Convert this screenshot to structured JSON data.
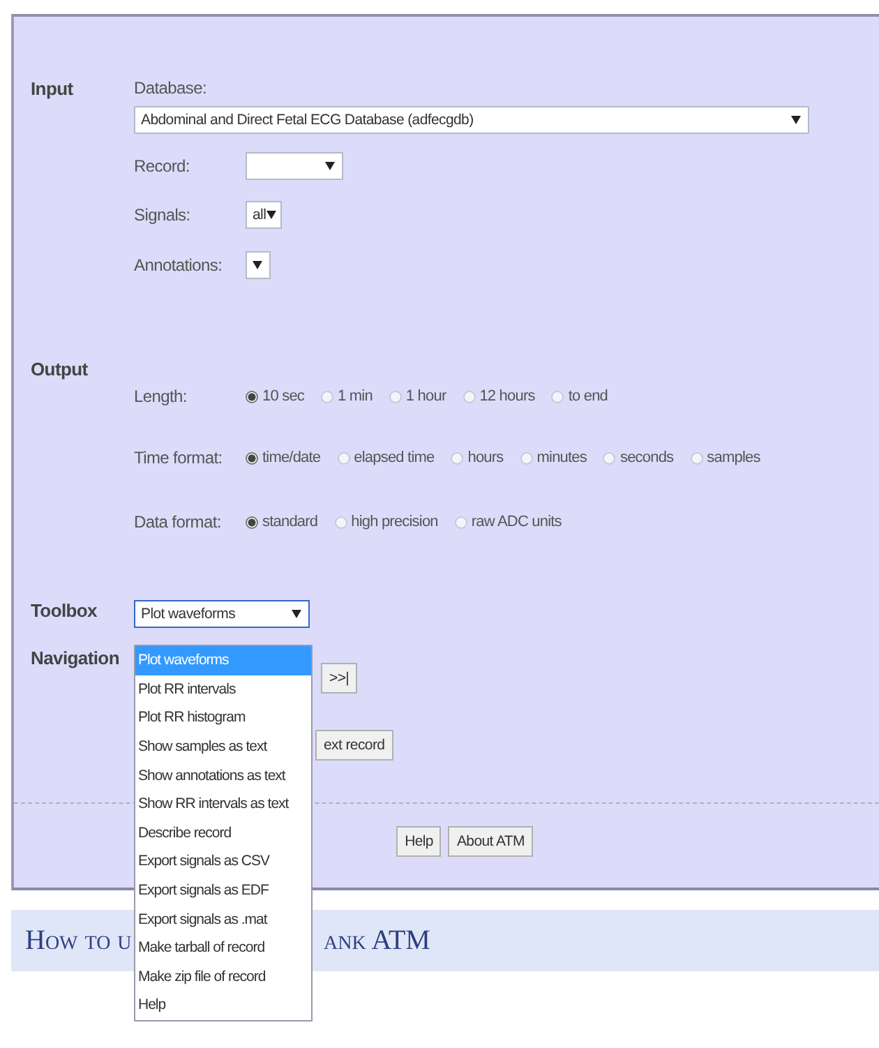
{
  "input": {
    "label": "Input",
    "database": {
      "label": "Database:",
      "value": "Abdominal and Direct Fetal ECG Database (adfecgdb)"
    },
    "fields": [
      {
        "label": "Record:"
      },
      {
        "label": "Signals:",
        "value": "all"
      },
      {
        "label": "Annotations:"
      }
    ]
  },
  "output": {
    "label": "Output",
    "groups": [
      {
        "label": "Length:",
        "options": [
          {
            "label": "10 sec",
            "selected": true
          },
          {
            "label": "1 min",
            "selected": false
          },
          {
            "label": "1 hour",
            "selected": false
          },
          {
            "label": "12 hours",
            "selected": false
          },
          {
            "label": "to end",
            "selected": false
          }
        ]
      },
      {
        "label": "Time format:",
        "options": [
          {
            "label": "time/date",
            "selected": true
          },
          {
            "label": "elapsed time",
            "selected": false
          },
          {
            "label": "hours",
            "selected": false
          },
          {
            "label": "minutes",
            "selected": false
          },
          {
            "label": "seconds",
            "selected": false
          },
          {
            "label": "samples",
            "selected": false
          }
        ]
      },
      {
        "label": "Data format:",
        "options": [
          {
            "label": "standard",
            "selected": true
          },
          {
            "label": "high precision",
            "selected": false
          },
          {
            "label": "raw ADC units",
            "selected": false
          }
        ]
      }
    ]
  },
  "toolbox": {
    "label": "Toolbox",
    "value": "Plot waveforms",
    "expanded": true,
    "options": [
      {
        "label": "Plot waveforms",
        "selected": true
      },
      {
        "label": "Plot RR intervals",
        "selected": false
      },
      {
        "label": "Plot RR histogram",
        "selected": false
      },
      {
        "label": "Show samples as text",
        "selected": false
      },
      {
        "label": "Show annotations as text",
        "selected": false
      },
      {
        "label": "Show RR intervals as text",
        "selected": false
      },
      {
        "label": "Describe record",
        "selected": false
      },
      {
        "label": "Export signals as CSV",
        "selected": false
      },
      {
        "label": "Export signals as EDF",
        "selected": false
      },
      {
        "label": "Export signals as .mat",
        "selected": false
      },
      {
        "label": "Make tarball of record",
        "selected": false
      },
      {
        "label": "Make zip file of record",
        "selected": false
      },
      {
        "label": "Help",
        "selected": false
      }
    ]
  },
  "navigation": {
    "label": "Navigation",
    "buttons": [
      ">>|",
      "ext record"
    ]
  },
  "footer_buttons": [
    "Help",
    "About ATM"
  ],
  "heading": {
    "parts": [
      "How to u",
      "ank ATM"
    ]
  }
}
